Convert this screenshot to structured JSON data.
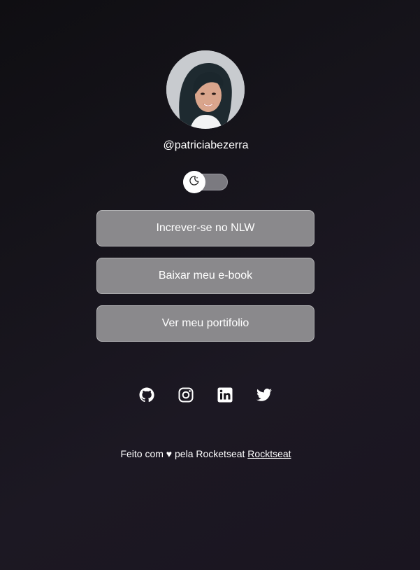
{
  "profile": {
    "username": "@patriciabezerra"
  },
  "theme_switch": {
    "mode": "dark",
    "icon": "moon-icon"
  },
  "links": [
    {
      "label": "Increver-se no NLW"
    },
    {
      "label": "Baixar meu e-book"
    },
    {
      "label": "Ver meu portifolio"
    }
  ],
  "social": [
    "github-icon",
    "instagram-icon",
    "linkedin-icon",
    "twitter-icon"
  ],
  "footer": {
    "text": "Feito com ♥ pela Rocketseat",
    "link_text": "Rocktseat"
  },
  "colors": {
    "button_bg": "#8a898c",
    "button_border": "#b5b5b7",
    "text": "#ffffff"
  }
}
